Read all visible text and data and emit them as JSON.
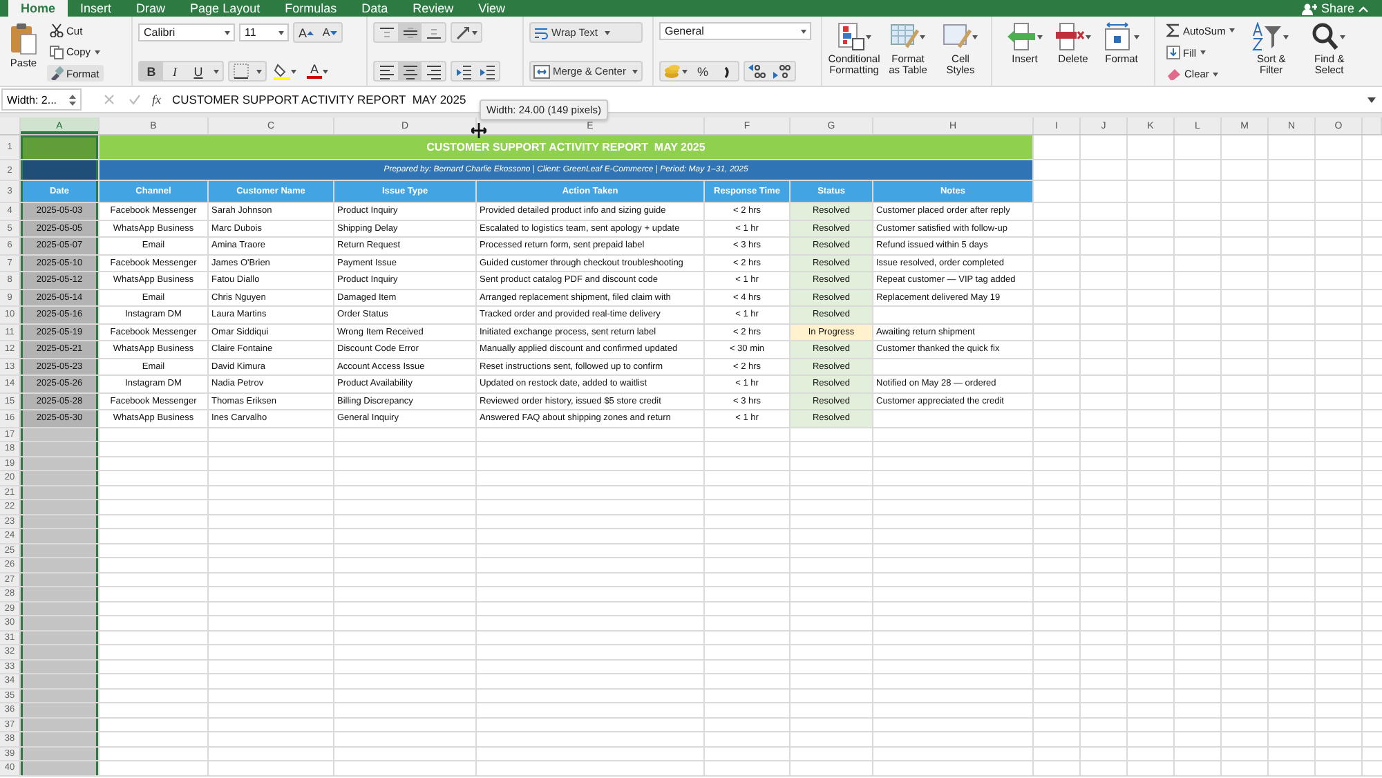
{
  "ribbon_tabs": [
    {
      "label": "Home",
      "selected": true
    },
    {
      "label": "Insert",
      "selected": false
    },
    {
      "label": "Draw",
      "selected": false
    },
    {
      "label": "Page Layout",
      "selected": false
    },
    {
      "label": "Formulas",
      "selected": false
    },
    {
      "label": "Data",
      "selected": false
    },
    {
      "label": "Review",
      "selected": false
    },
    {
      "label": "View",
      "selected": false
    }
  ],
  "share": "Share",
  "clipboard": {
    "paste": "Paste",
    "cut": "Cut",
    "copy": "Copy",
    "format": "Format"
  },
  "font": {
    "name": "Calibri",
    "size": "11",
    "grow": "A",
    "shrink": "A",
    "color_button": "A",
    "styles": [
      {
        "label": "B",
        "kind": "bold",
        "selected": true
      },
      {
        "label": "I",
        "kind": "italic",
        "selected": false
      },
      {
        "label": "U",
        "kind": "underline",
        "selected": false
      }
    ]
  },
  "vertical_align": [
    {
      "kind": "top",
      "selected": false
    },
    {
      "kind": "middle",
      "selected": true
    },
    {
      "kind": "bottom",
      "selected": false
    }
  ],
  "horizontal_align": [
    {
      "kind": "left",
      "selected": false
    },
    {
      "kind": "center",
      "selected": true
    },
    {
      "kind": "right",
      "selected": false
    }
  ],
  "wrap_text": "Wrap Text",
  "merge_center": "Merge & Center",
  "number": {
    "format": "General",
    "percent": "%"
  },
  "styles_group": [
    "Conditional Formatting",
    "Format as Table",
    "Cell Styles"
  ],
  "cells_group": [
    {
      "label": "Insert",
      "kind": "insert"
    },
    {
      "label": "Delete",
      "kind": "delete"
    },
    {
      "label": "Format",
      "kind": "format"
    }
  ],
  "editing": {
    "autosum": "AutoSum",
    "fill": "Fill",
    "clear": "Clear",
    "sort": "Sort & Filter",
    "find": "Find & Select"
  },
  "formula_bar": {
    "name_box": "Width: 2...",
    "fx": "fx",
    "content": "CUSTOMER SUPPORT ACTIVITY REPORT  MAY 2025"
  },
  "tooltip": "Width: 24.00 (149 pixels)",
  "columns": [
    {
      "label": "A",
      "selected": true
    },
    {
      "label": "B",
      "selected": false
    },
    {
      "label": "C",
      "selected": false
    },
    {
      "label": "D",
      "selected": false
    },
    {
      "label": "E",
      "selected": false
    },
    {
      "label": "F",
      "selected": false
    },
    {
      "label": "G",
      "selected": false
    },
    {
      "label": "H",
      "selected": false
    },
    {
      "label": "I",
      "selected": false
    },
    {
      "label": "J",
      "selected": false
    },
    {
      "label": "K",
      "selected": false
    },
    {
      "label": "L",
      "selected": false
    },
    {
      "label": "M",
      "selected": false
    },
    {
      "label": "N",
      "selected": false
    },
    {
      "label": "O",
      "selected": false
    }
  ],
  "row_numbers": [
    "1",
    "2",
    "3",
    "4",
    "5",
    "6",
    "7",
    "8",
    "9",
    "10",
    "11",
    "12",
    "13",
    "14",
    "15",
    "16",
    "17",
    "18",
    "19",
    "20",
    "21",
    "22",
    "23",
    "24",
    "25",
    "26",
    "27",
    "28",
    "29",
    "30",
    "31",
    "32",
    "33",
    "34",
    "35",
    "36",
    "37",
    "38",
    "39",
    "40"
  ],
  "report": {
    "title": "CUSTOMER SUPPORT ACTIVITY REPORT  MAY 2025",
    "subtitle": "Prepared by: Bernard Charlie Ekossono  |  Client: GreenLeaf E-Commerce  |  Period: May 1–31, 2025",
    "headers": [
      "Date",
      "Channel",
      "Customer Name",
      "Issue Type",
      "Action Taken",
      "Response Time",
      "Status",
      "Notes"
    ],
    "rows": [
      {
        "date": "2025-05-03",
        "channel": "Facebook Messenger",
        "customer": "Sarah Johnson",
        "issue": "Product Inquiry",
        "action": "Provided detailed product info and sizing guide",
        "response": "< 2 hrs",
        "status": {
          "text": "Resolved",
          "color": "#e2efda"
        },
        "notes": "Customer placed order after reply"
      },
      {
        "date": "2025-05-05",
        "channel": "WhatsApp Business",
        "customer": "Marc Dubois",
        "issue": "Shipping Delay",
        "action": "Escalated to logistics team, sent apology + update",
        "response": "< 1 hr",
        "status": {
          "text": "Resolved",
          "color": "#e2efda"
        },
        "notes": "Customer satisfied with follow-up"
      },
      {
        "date": "2025-05-07",
        "channel": "Email",
        "customer": "Amina Traore",
        "issue": "Return Request",
        "action": "Processed return form, sent prepaid label",
        "response": "< 3 hrs",
        "status": {
          "text": "Resolved",
          "color": "#e2efda"
        },
        "notes": "Refund issued within 5 days"
      },
      {
        "date": "2025-05-10",
        "channel": "Facebook Messenger",
        "customer": "James O'Brien",
        "issue": "Payment Issue",
        "action": "Guided customer through checkout troubleshooting",
        "response": "< 2 hrs",
        "status": {
          "text": "Resolved",
          "color": "#e2efda"
        },
        "notes": "Issue resolved, order completed"
      },
      {
        "date": "2025-05-12",
        "channel": "WhatsApp Business",
        "customer": "Fatou Diallo",
        "issue": "Product Inquiry",
        "action": "Sent product catalog PDF and discount code",
        "response": "< 1 hr",
        "status": {
          "text": "Resolved",
          "color": "#e2efda"
        },
        "notes": "Repeat customer — VIP tag added"
      },
      {
        "date": "2025-05-14",
        "channel": "Email",
        "customer": "Chris Nguyen",
        "issue": "Damaged Item",
        "action": "Arranged replacement shipment, filed claim with",
        "response": "< 4 hrs",
        "status": {
          "text": "Resolved",
          "color": "#e2efda"
        },
        "notes": "Replacement delivered May 19"
      },
      {
        "date": "2025-05-16",
        "channel": "Instagram DM",
        "customer": "Laura Martins",
        "issue": "Order Status",
        "action": "Tracked order and provided real-time delivery",
        "response": "< 1 hr",
        "status": {
          "text": "Resolved",
          "color": "#e2efda"
        }
      },
      {
        "date": "2025-05-19",
        "channel": "Facebook Messenger",
        "customer": "Omar Siddiqui",
        "issue": "Wrong Item Received",
        "action": "Initiated exchange process, sent return label",
        "response": "< 2 hrs",
        "status": {
          "text": "In Progress",
          "color": "#fff2cc"
        },
        "notes": "Awaiting return shipment"
      },
      {
        "date": "2025-05-21",
        "channel": "WhatsApp Business",
        "customer": "Claire Fontaine",
        "issue": "Discount Code Error",
        "action": "Manually applied discount and confirmed updated",
        "response": "< 30 min",
        "status": {
          "text": "Resolved",
          "color": "#e2efda"
        },
        "notes": "Customer thanked the quick fix"
      },
      {
        "date": "2025-05-23",
        "channel": "Email",
        "customer": "David Kimura",
        "issue": "Account Access Issue",
        "action": "Reset instructions sent, followed up to confirm",
        "response": "< 2 hrs",
        "status": {
          "text": "Resolved",
          "color": "#e2efda"
        }
      },
      {
        "date": "2025-05-26",
        "channel": "Instagram DM",
        "customer": "Nadia Petrov",
        "issue": "Product Availability",
        "action": "Updated on restock date, added to waitlist",
        "response": "< 1 hr",
        "status": {
          "text": "Resolved",
          "color": "#e2efda"
        },
        "notes": "Notified on May 28 — ordered"
      },
      {
        "date": "2025-05-28",
        "channel": "Facebook Messenger",
        "customer": "Thomas Eriksen",
        "issue": "Billing Discrepancy",
        "action": "Reviewed order history, issued $5 store credit",
        "response": "< 3 hrs",
        "status": {
          "text": "Resolved",
          "color": "#e2efda"
        },
        "notes": "Customer appreciated the credit"
      },
      {
        "date": "2025-05-30",
        "channel": "WhatsApp Business",
        "customer": "Ines Carvalho",
        "issue": "General Inquiry",
        "action": "Answered FAQ about shipping zones and return",
        "response": "< 1 hr",
        "status": {
          "text": "Resolved",
          "color": "#e2efda"
        }
      }
    ]
  }
}
